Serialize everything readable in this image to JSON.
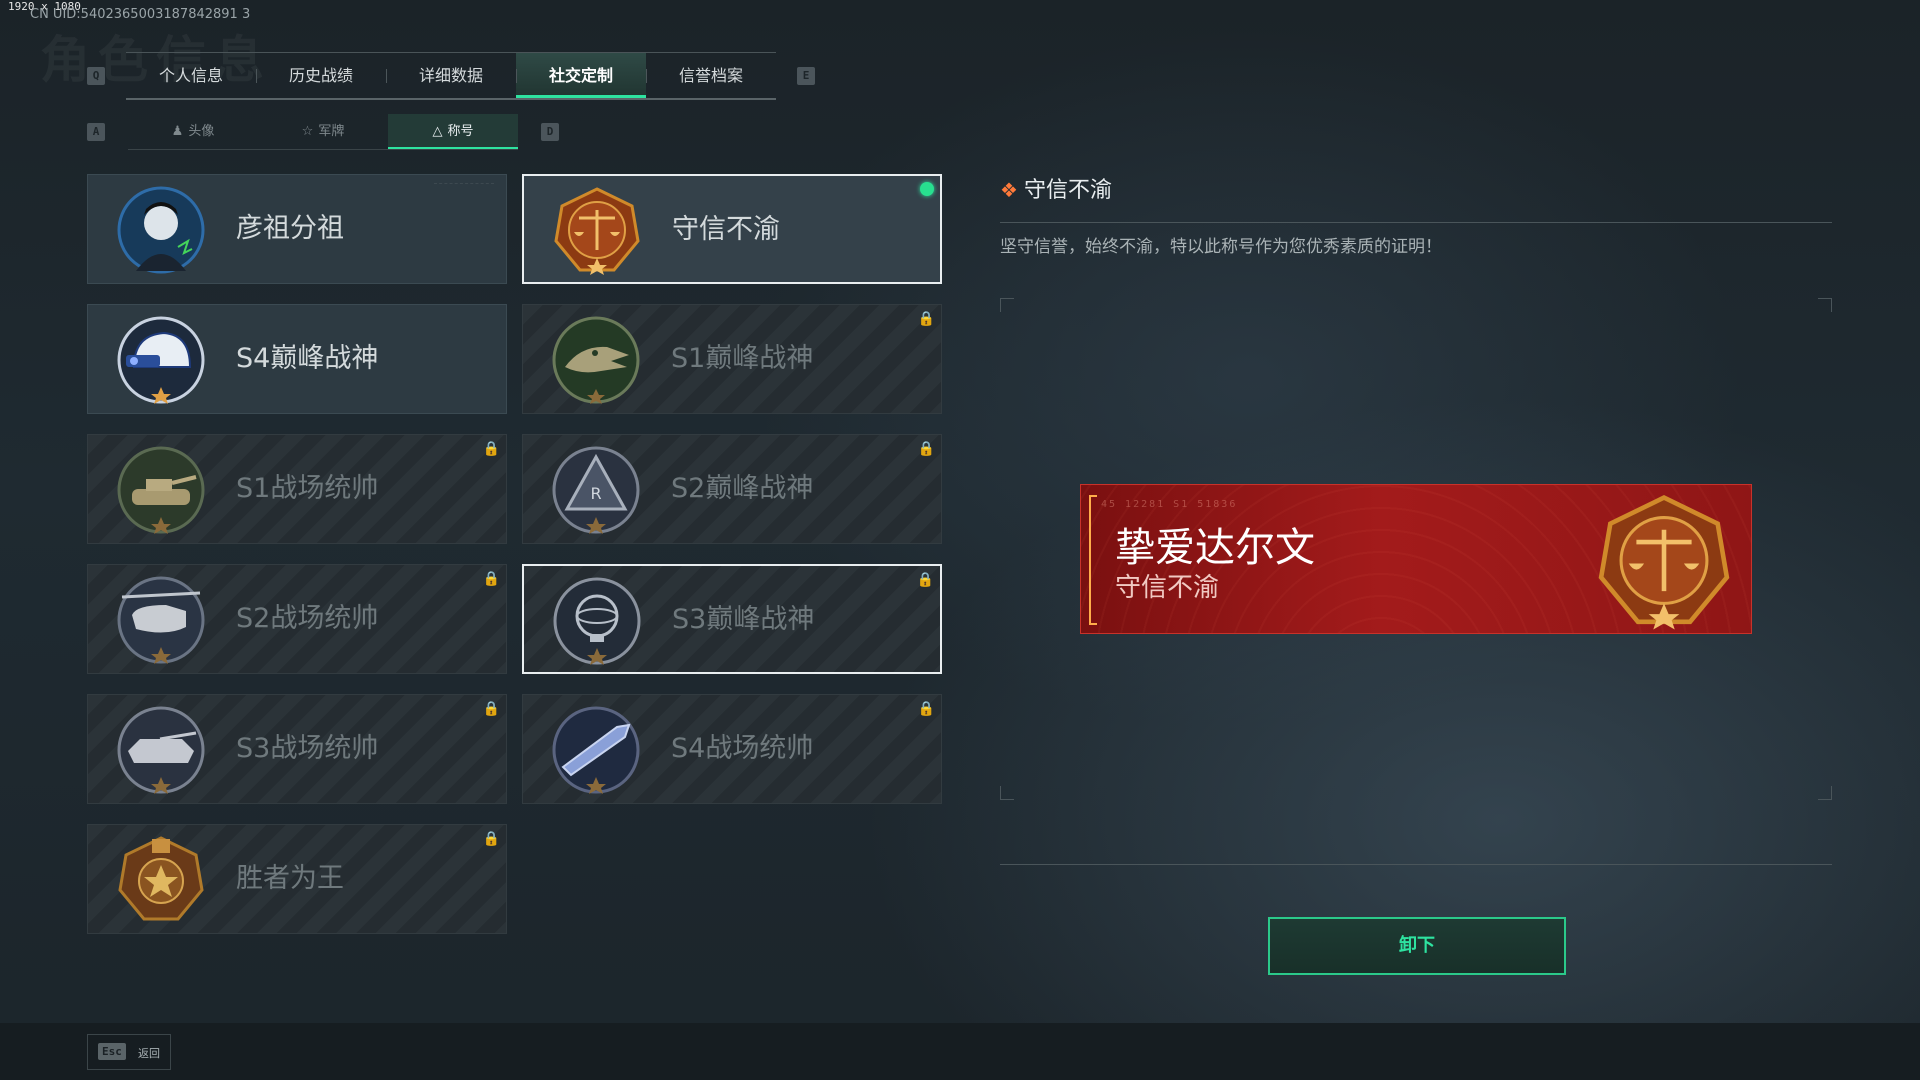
{
  "resolution_label": "1920 x 1080",
  "uid": "CN UID:5402365003187842891 3",
  "background_title": "角色信息",
  "keys": {
    "prev_tab": "Q",
    "next_tab": "E",
    "prev_subtab": "A",
    "next_subtab": "D"
  },
  "tabs": [
    {
      "label": "个人信息"
    },
    {
      "label": "历史战绩"
    },
    {
      "label": "详细数据"
    },
    {
      "label": "社交定制"
    },
    {
      "label": "信誉档案"
    }
  ],
  "subtabs": [
    {
      "label": "头像",
      "icon": "person-icon"
    },
    {
      "label": "军牌",
      "icon": "dogtag-icon"
    },
    {
      "label": "称号",
      "icon": "triangle-icon"
    }
  ],
  "titles": [
    {
      "name": "彦祖分祖",
      "locked": false,
      "badge": "portrait-badge"
    },
    {
      "name": "守信不渝",
      "locked": false,
      "equipped": true,
      "badge": "scales-badge"
    },
    {
      "name": "S4巅峰战神",
      "locked": false,
      "badge": "helmet-badge"
    },
    {
      "name": "S1巅峰战神",
      "locked": true,
      "badge": "crocodile-badge"
    },
    {
      "name": "S1战场统帅",
      "locked": true,
      "badge": "tank-badge"
    },
    {
      "name": "S2巅峰战神",
      "locked": true,
      "badge": "triangle-r-badge"
    },
    {
      "name": "S2战场统帅",
      "locked": true,
      "badge": "helicopter-badge"
    },
    {
      "name": "S3巅峰战神",
      "locked": true,
      "badge": "globe-badge"
    },
    {
      "name": "S3战场统帅",
      "locked": true,
      "badge": "ifv-badge"
    },
    {
      "name": "S4战场统帅",
      "locked": true,
      "badge": "missile-badge"
    },
    {
      "name": "胜者为王",
      "locked": true,
      "badge": "medal-badge"
    }
  ],
  "detail": {
    "title": "守信不渝",
    "description": "坚守信誉，始终不渝，特以此称号作为您优秀素质的证明！"
  },
  "banner": {
    "codes": "45 12281   S1 51836",
    "player_name": "挚爱达尔文",
    "title": "守信不渝"
  },
  "unequip_label": "卸下",
  "back": {
    "key": "Esc",
    "label": "返回"
  },
  "colors": {
    "accent": "#2ee3a0",
    "banner_red": "#a31b1b",
    "badge_gold": "#d08a2a"
  }
}
